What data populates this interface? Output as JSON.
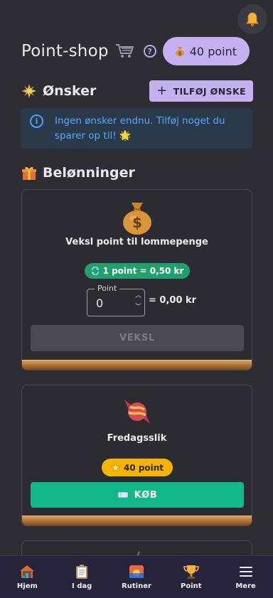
{
  "header": {
    "title": "Point-shop",
    "points_balance": "40 point",
    "help_glyph": "?"
  },
  "wishes": {
    "heading": "Ønsker",
    "add_button": "TILFØJ ØNSKE",
    "empty_info": "Ingen ønsker endnu. Tilføj noget du sparer op til! 🌟"
  },
  "rewards": {
    "heading": "Belønninger",
    "exchange": {
      "title": "Veksl point til lommepenge",
      "rate": "1 point = 0,50 kr",
      "field_label": "Point",
      "field_value": "0",
      "result": "= 0,00 kr",
      "button": "VEKSL"
    },
    "items": [
      {
        "title": "Fredagsslik",
        "price": "40 point",
        "button": "KØB"
      }
    ]
  },
  "nav": [
    {
      "label": "Hjem",
      "icon": "house-icon"
    },
    {
      "label": "I dag",
      "icon": "clipboard-icon"
    },
    {
      "label": "Rutiner",
      "icon": "sunrise-icon"
    },
    {
      "label": "Point",
      "icon": "trophy-icon"
    },
    {
      "label": "Mere",
      "icon": "menu-icon"
    }
  ],
  "colors": {
    "background": "#2d2d33",
    "accent": "#c3b2ef",
    "info_text": "#58a8ff",
    "rate_green": "#21a06a",
    "price_yellow": "#f4b400",
    "buy_green": "#12b886",
    "nav_bg": "#27233a"
  }
}
